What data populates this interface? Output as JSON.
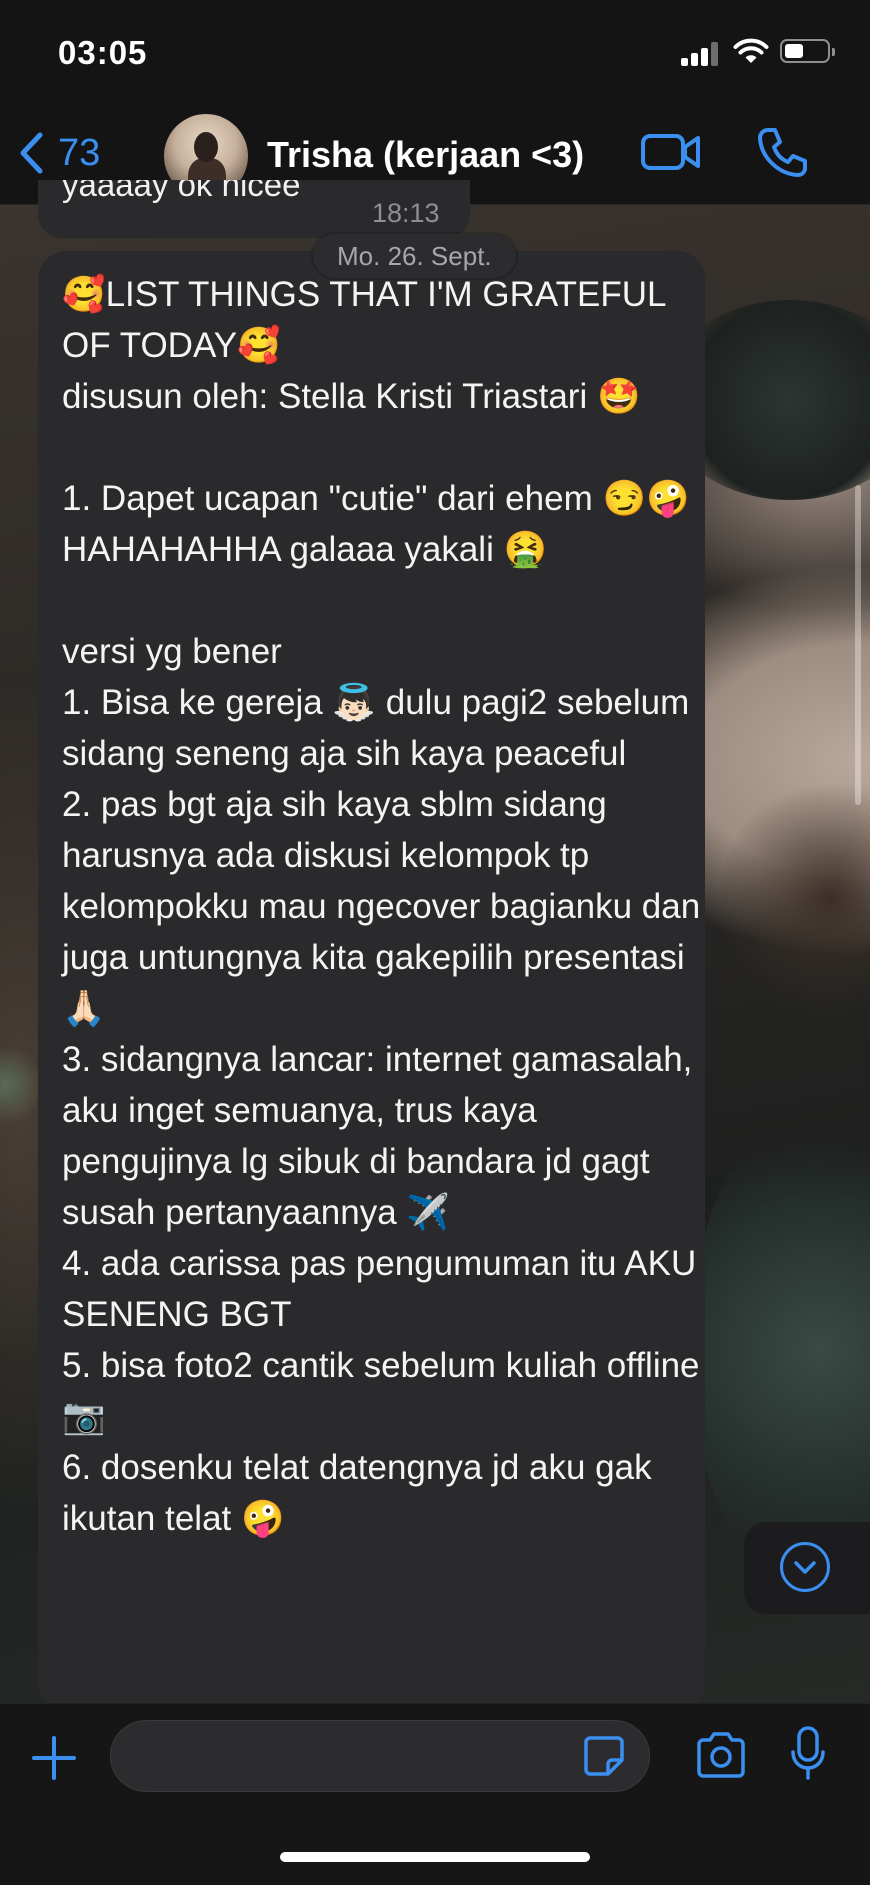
{
  "status_bar": {
    "time": "03:05"
  },
  "header": {
    "back_count": "73",
    "contact_name": "Trisha (kerjaan <3)"
  },
  "chat": {
    "previous_message": {
      "text": "yaaaay ok nicee",
      "time": "18:13"
    },
    "date_separator": "Mo. 26. Sept.",
    "message": {
      "text": "🥰LIST THINGS THAT I'M GRATEFUL OF TODAY🥰\ndisusun oleh: Stella Kristi Triastari 🤩\n\n1. Dapet ucapan \"cutie\" dari ehem 😏🤪\nHAHAHAHHA galaaa yakali 🤮\n\nversi yg bener\n1. Bisa ke gereja 👼🏻 dulu pagi2 sebelum sidang seneng aja sih kaya peaceful\n2. pas bgt aja sih kaya sblm sidang harusnya ada diskusi kelompok tp kelompokku mau ngecover bagianku dan juga untungnya kita gakepilih presentasi 🙏🏻\n3. sidangnya lancar: internet gamasalah, aku inget semuanya, trus kaya pengujinya lg sibuk di bandara jd gagt susah pertanyaannya ✈️\n4. ada carissa pas pengumuman itu AKU SENENG BGT\n5. bisa foto2 cantik sebelum kuliah offline 📷\n6. dosenku telat datengnya jd aku gak ikutan telat 🤪"
    }
  },
  "composer": {
    "placeholder": ""
  },
  "colors": {
    "accent": "#3a8ff0",
    "bubble": "#2a2a2c",
    "bar": "#141414"
  }
}
